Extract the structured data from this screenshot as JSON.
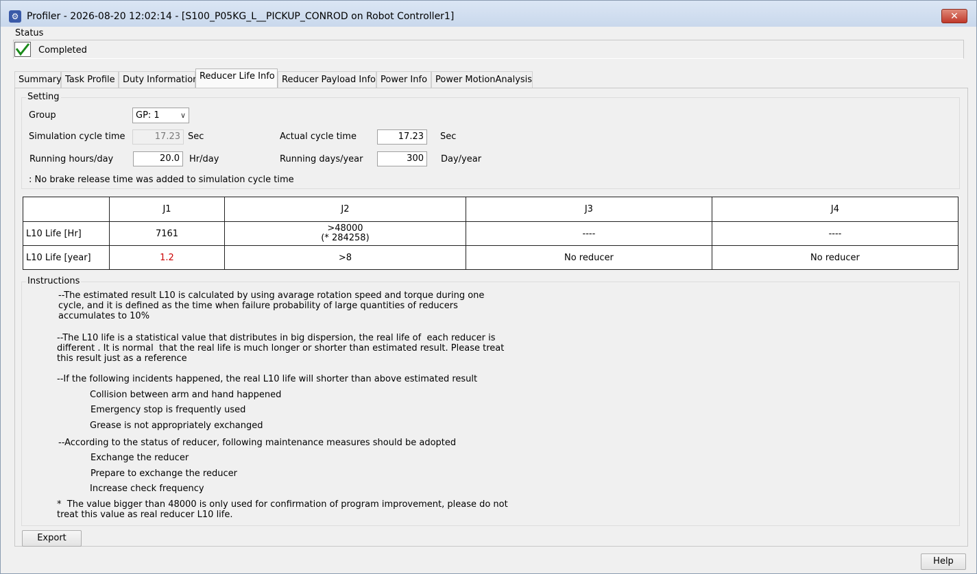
{
  "window": {
    "title": "Profiler - 2026-08-20 12:02:14 - [S100_P05KG_L__PICKUP_CONROD on Robot Controller1]",
    "close_glyph": "✕",
    "icon_glyph": "⚙"
  },
  "status": {
    "label": "Status",
    "text": "Completed",
    "check_glyph": "✔"
  },
  "tabs": [
    {
      "label": "Summary"
    },
    {
      "label": "Task Profile"
    },
    {
      "label": "Duty Information"
    },
    {
      "label": "Reducer Life Info",
      "active": true
    },
    {
      "label": "Reducer Payload Info"
    },
    {
      "label": "Power Info"
    },
    {
      "label": "Power MotionAnalysis"
    }
  ],
  "setting": {
    "legend": "Setting",
    "group_label": "Group",
    "group_value": "GP: 1",
    "sim_cycle_label": "Simulation cycle time",
    "sim_cycle_value": "17.23",
    "sim_cycle_unit": "Sec",
    "actual_cycle_label": "Actual cycle time",
    "actual_cycle_value": "17.23",
    "actual_cycle_unit": "Sec",
    "hours_label": "Running hours/day",
    "hours_value": "20.0",
    "hours_unit": "Hr/day",
    "days_label": "Running days/year",
    "days_value": "300",
    "days_unit": "Day/year",
    "note": ": No brake release time was added to simulation cycle time"
  },
  "table": {
    "headers": [
      "",
      "J1",
      "J2",
      "J3",
      "J4"
    ],
    "rows": [
      {
        "label": "L10 Life [Hr]",
        "cells": [
          "7161",
          ">48000\n(* 284258)",
          "----",
          "----"
        ]
      },
      {
        "label": "L10 Life [year]",
        "cells": [
          "1.2",
          ">8",
          "No reducer",
          "No reducer"
        ]
      }
    ]
  },
  "instructions": {
    "legend": "Instructions",
    "p1": "--The estimated result L10 is calculated by using avarage rotation speed and torque during one\ncycle, and it is defined as the time when failure probability of large quantities of reducers\naccumulates to 10%",
    "p2": "--The L10 life is a statistical value that distributes in big dispersion, the real life of  each reducer is\ndifferent . It is normal  that the real life is much longer or shorter than estimated result. Please treat\nthis result just as a reference",
    "p3": "--If the following incidents happened, the real L10 life will shorter than above estimated result",
    "p3_items": [
      "Collision between arm and hand happened",
      "Emergency stop is frequently used",
      "Grease is not appropriately exchanged"
    ],
    "p4": "--According to the status of reducer, following maintenance measures should be adopted",
    "p4_items": [
      "Exchange the reducer",
      "Prepare to exchange the reducer",
      "Increase check frequency"
    ],
    "p5": "*  The value bigger than 48000 is only used for confirmation of program improvement, please do not\ntreat this value as real reducer L10 life."
  },
  "buttons": {
    "export": "Export",
    "help": "Help"
  }
}
